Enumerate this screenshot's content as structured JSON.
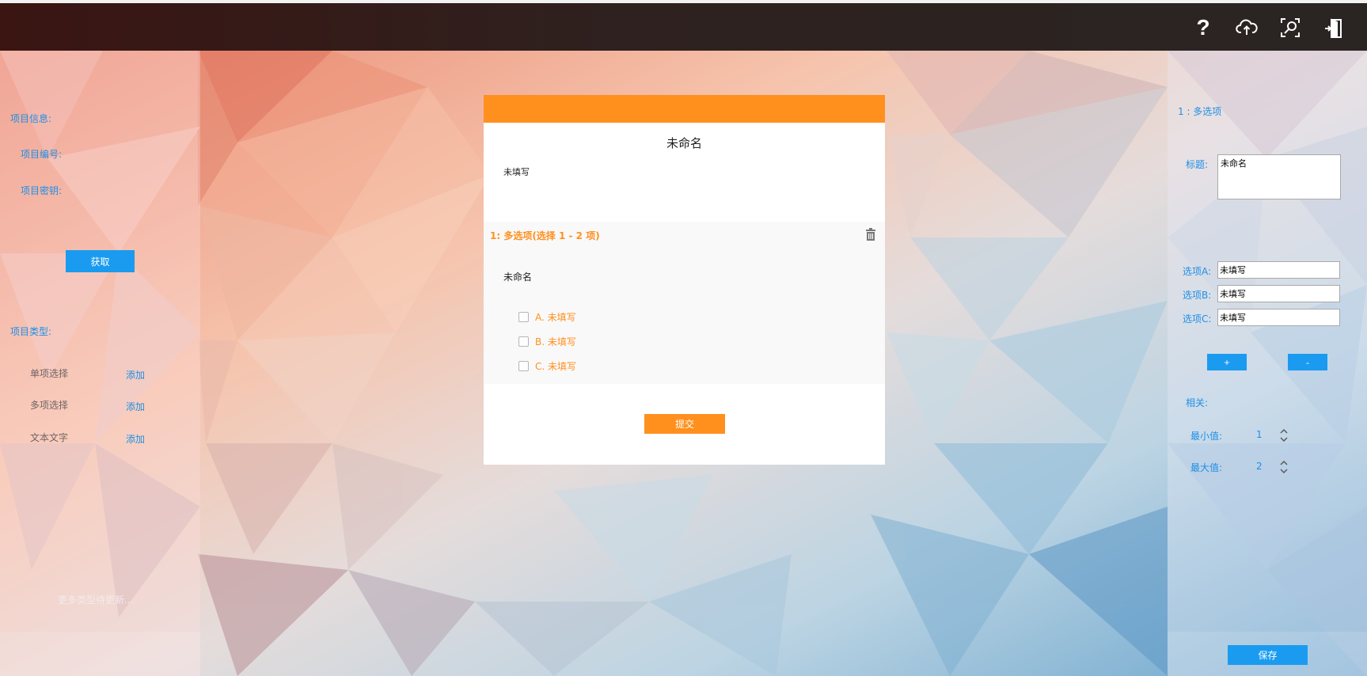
{
  "toolbar": {
    "help_glyph": "?",
    "icons": [
      "help-icon",
      "cloud-upload-icon",
      "search-icon",
      "exit-icon"
    ]
  },
  "left_panel": {
    "project_info_label": "项目信息:",
    "project_number_label": "项目编号:",
    "project_key_label": "项目密钥:",
    "fetch_button": "获取",
    "project_type_label": "项目类型:",
    "types": [
      {
        "name": "单项选择",
        "action": "添加"
      },
      {
        "name": "多项选择",
        "action": "添加"
      },
      {
        "name": "文本文字",
        "action": "添加"
      }
    ],
    "more_note": "更多类型待更新..."
  },
  "form": {
    "title": "未命名",
    "description": "未填写",
    "question": {
      "heading": "1: 多选项(选择 1 - 2 项)",
      "text": "未命名",
      "options": [
        "A. 未填写",
        "B. 未填写",
        "C. 未填写"
      ]
    },
    "submit_button": "提交"
  },
  "right_panel": {
    "question_label": "1 : 多选项",
    "title_label": "标题:",
    "title_value": "未命名",
    "options": [
      {
        "label": "选项A:",
        "value": "未填写"
      },
      {
        "label": "选项B:",
        "value": "未填写"
      },
      {
        "label": "选项C:",
        "value": "未填写"
      }
    ],
    "add_button": "+",
    "remove_button": "-",
    "related_label": "相关:",
    "min_label": "最小值:",
    "min_value": "1",
    "max_label": "最大值:",
    "max_value": "2",
    "save_button": "保存"
  },
  "colors": {
    "accent_orange": "#ff901e",
    "accent_blue": "#1a9bf0",
    "link_blue": "#1e8fe6",
    "topbar": "#2e211f"
  }
}
